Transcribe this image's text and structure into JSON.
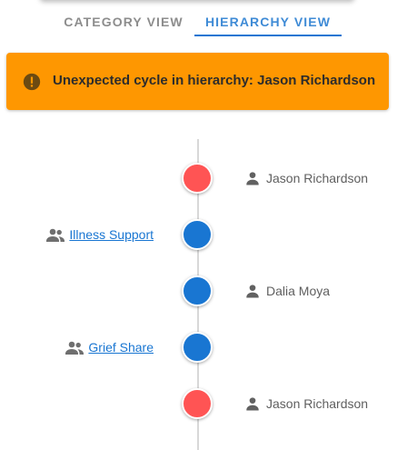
{
  "tabs": [
    {
      "label": "CATEGORY VIEW",
      "active": false
    },
    {
      "label": "HIERARCHY VIEW",
      "active": true
    }
  ],
  "alert": {
    "icon": "alert-circle-icon",
    "message": "Unexpected cycle in hierarchy: Jason Richardson",
    "color": "#fe9701"
  },
  "colors": {
    "cycle_node": "#ff5454",
    "normal_node": "#1976d2",
    "link": "#1976d2",
    "accent": "#1976d2"
  },
  "timeline": [
    {
      "side": "right",
      "kind": "person",
      "icon": "person-icon",
      "label": "Jason Richardson",
      "status": "cycle"
    },
    {
      "side": "left",
      "kind": "group",
      "icon": "group-icon",
      "label": "Illness Support",
      "status": "normal"
    },
    {
      "side": "right",
      "kind": "person",
      "icon": "person-icon",
      "label": "Dalia Moya",
      "status": "normal"
    },
    {
      "side": "left",
      "kind": "group",
      "icon": "group-icon",
      "label": "Grief Share",
      "status": "normal"
    },
    {
      "side": "right",
      "kind": "person",
      "icon": "person-icon",
      "label": "Jason Richardson",
      "status": "cycle"
    }
  ]
}
